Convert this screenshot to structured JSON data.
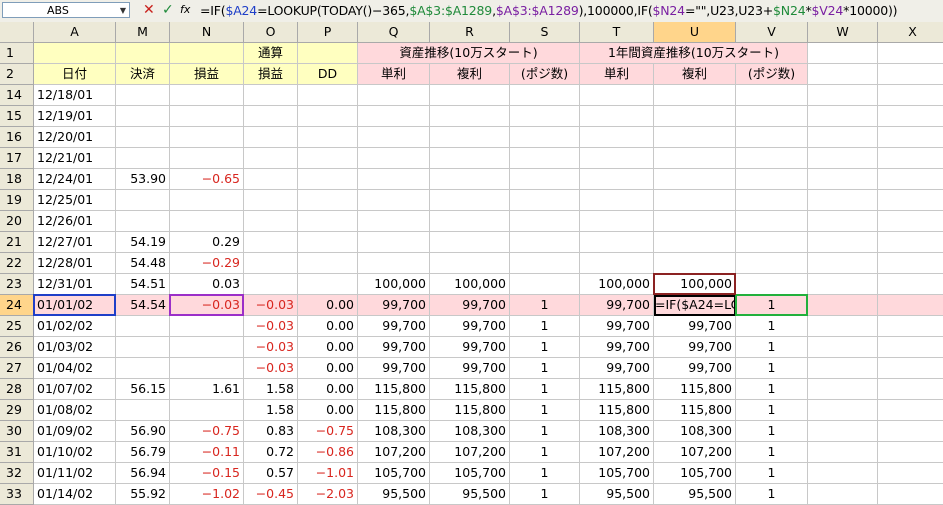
{
  "formula_bar": {
    "name_box": "ABS",
    "cancel_glyph": "✕",
    "enter_glyph": "✓",
    "fx_glyph": "fx",
    "formula_parts": [
      {
        "t": "=IF(",
        "c": ""
      },
      {
        "t": "$A24",
        "c": "blue"
      },
      {
        "t": "=LOOKUP(TODAY()−365,",
        "c": ""
      },
      {
        "t": "$A$3:$A1289",
        "c": "green"
      },
      {
        "t": ",",
        "c": ""
      },
      {
        "t": "$A$3:$A1289",
        "c": "purple"
      },
      {
        "t": "),100000,IF(",
        "c": ""
      },
      {
        "t": "$N24",
        "c": "purple"
      },
      {
        "t": "=\"\",U23,U23+",
        "c": ""
      },
      {
        "t": "$N24",
        "c": "green"
      },
      {
        "t": "*",
        "c": ""
      },
      {
        "t": "$V24",
        "c": "purple"
      },
      {
        "t": "*10000))",
        "c": ""
      }
    ]
  },
  "columns": [
    "A",
    "M",
    "N",
    "O",
    "P",
    "Q",
    "R",
    "S",
    "T",
    "U",
    "V",
    "W",
    "X"
  ],
  "header_row1": {
    "O": "通算",
    "QRS": "資産推移(10万スタート)",
    "TUV": "1年間資産推移(10万スタート)"
  },
  "header_row2": {
    "A": "日付",
    "M": "決済",
    "N": "損益",
    "O": "損益",
    "P": "DD",
    "Q": "単利",
    "R": "複利",
    "S": "(ポジ数)",
    "T": "単利",
    "U": "複利",
    "V": "(ポジ数)"
  },
  "rows": [
    {
      "n": "14",
      "A": "12/18/01",
      "M": "",
      "N": "",
      "O": "",
      "P": "",
      "Q": "",
      "R": "",
      "S": "",
      "T": "",
      "U": "",
      "V": ""
    },
    {
      "n": "15",
      "A": "12/19/01",
      "M": "",
      "N": "",
      "O": "",
      "P": "",
      "Q": "",
      "R": "",
      "S": "",
      "T": "",
      "U": "",
      "V": ""
    },
    {
      "n": "16",
      "A": "12/20/01",
      "M": "",
      "N": "",
      "O": "",
      "P": "",
      "Q": "",
      "R": "",
      "S": "",
      "T": "",
      "U": "",
      "V": ""
    },
    {
      "n": "17",
      "A": "12/21/01",
      "M": "",
      "N": "",
      "O": "",
      "P": "",
      "Q": "",
      "R": "",
      "S": "",
      "T": "",
      "U": "",
      "V": ""
    },
    {
      "n": "18",
      "A": "12/24/01",
      "M": "53.90",
      "N": "−0.65",
      "O": "",
      "P": "",
      "Q": "",
      "R": "",
      "S": "",
      "T": "",
      "U": "",
      "V": ""
    },
    {
      "n": "19",
      "A": "12/25/01",
      "M": "",
      "N": "",
      "O": "",
      "P": "",
      "Q": "",
      "R": "",
      "S": "",
      "T": "",
      "U": "",
      "V": ""
    },
    {
      "n": "20",
      "A": "12/26/01",
      "M": "",
      "N": "",
      "O": "",
      "P": "",
      "Q": "",
      "R": "",
      "S": "",
      "T": "",
      "U": "",
      "V": ""
    },
    {
      "n": "21",
      "A": "12/27/01",
      "M": "54.19",
      "N": "0.29",
      "O": "",
      "P": "",
      "Q": "",
      "R": "",
      "S": "",
      "T": "",
      "U": "",
      "V": ""
    },
    {
      "n": "22",
      "A": "12/28/01",
      "M": "54.48",
      "N": "−0.29",
      "O": "",
      "P": "",
      "Q": "",
      "R": "",
      "S": "",
      "T": "",
      "U": "",
      "V": ""
    },
    {
      "n": "23",
      "A": "12/31/01",
      "M": "54.51",
      "N": "0.03",
      "O": "",
      "P": "",
      "Q": "100,000",
      "R": "100,000",
      "S": "",
      "T": "100,000",
      "U": "100,000",
      "V": ""
    },
    {
      "n": "24",
      "A": "01/01/02",
      "M": "54.54",
      "N": "−0.03",
      "O": "−0.03",
      "P": "0.00",
      "Q": "99,700",
      "R": "99,700",
      "S": "1",
      "T": "99,700",
      "U": "=IF($A24=LO",
      "V": "1"
    },
    {
      "n": "25",
      "A": "01/02/02",
      "M": "",
      "N": "",
      "O": "−0.03",
      "P": "0.00",
      "Q": "99,700",
      "R": "99,700",
      "S": "1",
      "T": "99,700",
      "U": "99,700",
      "V": "1"
    },
    {
      "n": "26",
      "A": "01/03/02",
      "M": "",
      "N": "",
      "O": "−0.03",
      "P": "0.00",
      "Q": "99,700",
      "R": "99,700",
      "S": "1",
      "T": "99,700",
      "U": "99,700",
      "V": "1"
    },
    {
      "n": "27",
      "A": "01/04/02",
      "M": "",
      "N": "",
      "O": "−0.03",
      "P": "0.00",
      "Q": "99,700",
      "R": "99,700",
      "S": "1",
      "T": "99,700",
      "U": "99,700",
      "V": "1"
    },
    {
      "n": "28",
      "A": "01/07/02",
      "M": "56.15",
      "N": "1.61",
      "O": "1.58",
      "P": "0.00",
      "Q": "115,800",
      "R": "115,800",
      "S": "1",
      "T": "115,800",
      "U": "115,800",
      "V": "1"
    },
    {
      "n": "29",
      "A": "01/08/02",
      "M": "",
      "N": "",
      "O": "1.58",
      "P": "0.00",
      "Q": "115,800",
      "R": "115,800",
      "S": "1",
      "T": "115,800",
      "U": "115,800",
      "V": "1"
    },
    {
      "n": "30",
      "A": "01/09/02",
      "M": "56.90",
      "N": "−0.75",
      "O": "0.83",
      "P": "−0.75",
      "Q": "108,300",
      "R": "108,300",
      "S": "1",
      "T": "108,300",
      "U": "108,300",
      "V": "1"
    },
    {
      "n": "31",
      "A": "01/10/02",
      "M": "56.79",
      "N": "−0.11",
      "O": "0.72",
      "P": "−0.86",
      "Q": "107,200",
      "R": "107,200",
      "S": "1",
      "T": "107,200",
      "U": "107,200",
      "V": "1"
    },
    {
      "n": "32",
      "A": "01/11/02",
      "M": "56.94",
      "N": "−0.15",
      "O": "0.57",
      "P": "−1.01",
      "Q": "105,700",
      "R": "105,700",
      "S": "1",
      "T": "105,700",
      "U": "105,700",
      "V": "1"
    },
    {
      "n": "33",
      "A": "01/14/02",
      "M": "55.92",
      "N": "−1.02",
      "O": "−0.45",
      "P": "−2.03",
      "Q": "95,500",
      "R": "95,500",
      "S": "1",
      "T": "95,500",
      "U": "95,500",
      "V": "1"
    }
  ]
}
